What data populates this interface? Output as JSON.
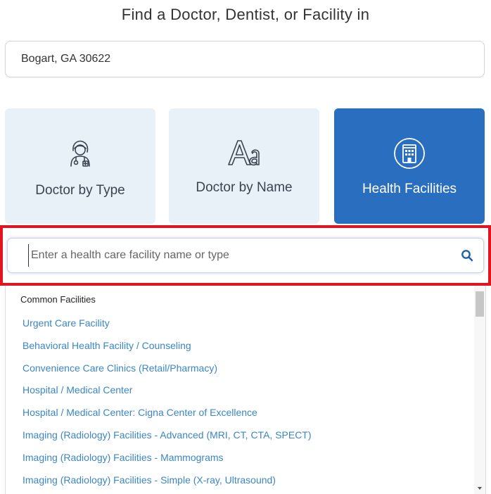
{
  "header": {
    "title": "Find a Doctor, Dentist, or Facility in"
  },
  "location": {
    "value": "Bogart, GA 30622"
  },
  "tiles": [
    {
      "label": "Doctor by Type",
      "icon": "doctor-icon",
      "active": false
    },
    {
      "label": "Doctor by Name",
      "icon": "letters-aa-icon",
      "active": false
    },
    {
      "label": "Health Facilities",
      "icon": "building-icon",
      "active": true
    }
  ],
  "search": {
    "placeholder": "Enter a health care facility name or type",
    "button_icon": "search-icon"
  },
  "dropdown": {
    "group_title": "Common Facilities",
    "items": [
      "Urgent Care Facility",
      "Behavioral Health Facility / Counseling",
      "Convenience Care Clinics (Retail/Pharmacy)",
      "Hospital / Medical Center",
      "Hospital / Medical Center: Cigna Center of Excellence",
      "Imaging (Radiology) Facilities - Advanced (MRI, CT, CTA, SPECT)",
      "Imaging (Radiology) Facilities - Mammograms",
      "Imaging (Radiology) Facilities - Simple (X-ray, Ultrasound)"
    ]
  },
  "colors": {
    "active_tile": "#2a6ec0",
    "inactive_tile": "#e8f1f7",
    "link": "#3a86c8",
    "highlight_border": "#e0151f"
  }
}
